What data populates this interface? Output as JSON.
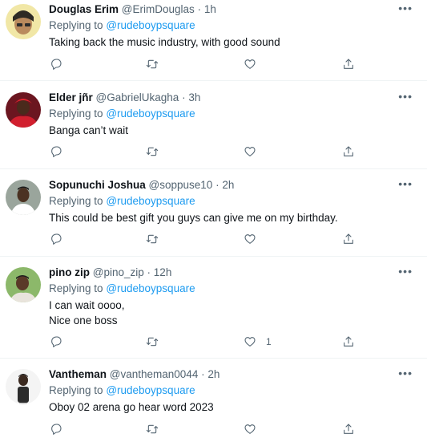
{
  "tweets": [
    {
      "name": "Douglas Erim",
      "handle": "@ErimDouglas",
      "dot": "·",
      "time": "1h",
      "replying_label": "Replying to",
      "replying_to": "@rudeboypsquare",
      "text": "Taking back the music industry, with good sound",
      "like_count": ""
    },
    {
      "name": "Elder jñr",
      "handle": "@GabrielUkagha",
      "dot": "·",
      "time": "3h",
      "replying_label": "Replying to",
      "replying_to": "@rudeboypsquare",
      "text": "Banga can’t wait",
      "like_count": ""
    },
    {
      "name": "Sopunuchi Joshua",
      "handle": "@soppuse10",
      "dot": "·",
      "time": "2h",
      "replying_label": "Replying to",
      "replying_to": "@rudeboypsquare",
      "text": "This could be best gift you guys can give me on my birthday.",
      "like_count": ""
    },
    {
      "name": "pino zip",
      "handle": "@pino_zip",
      "dot": "·",
      "time": "12h",
      "replying_label": "Replying to",
      "replying_to": "@rudeboypsquare",
      "text": "I can wait oooo,\nNice one boss",
      "like_count": "1"
    },
    {
      "name": "Vantheman",
      "handle": "@vantheman0044",
      "dot": "·",
      "time": "2h",
      "replying_label": "Replying to",
      "replying_to": "@rudeboypsquare",
      "text": "Oboy 02 arena go hear word 2023",
      "like_count": ""
    }
  ],
  "icons": {
    "more": "more-horizontal-icon",
    "reply": "reply-icon",
    "retweet": "retweet-icon",
    "like": "heart-icon",
    "share": "share-icon"
  },
  "colors": {
    "accent": "#1d9bf0",
    "text_primary": "#0f1419",
    "text_secondary": "#536471",
    "divider": "#eff3f4"
  }
}
